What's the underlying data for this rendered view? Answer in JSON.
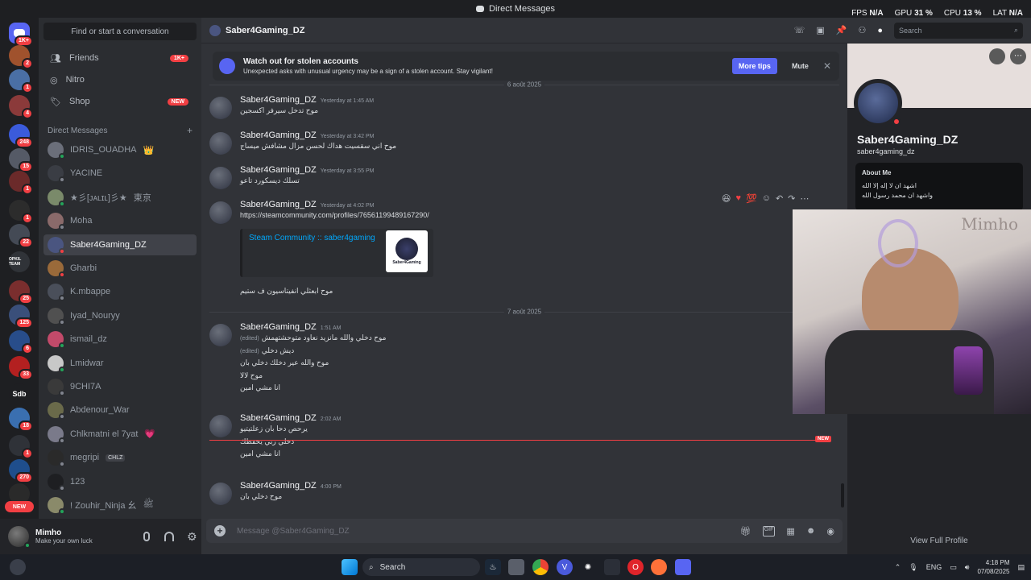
{
  "window": {
    "title": "Direct Messages"
  },
  "overlay": {
    "fps_label": "FPS",
    "fps_value": "N/A",
    "gpu_label": "GPU",
    "gpu_value": "31 %",
    "cpu_label": "CPU",
    "cpu_value": "13 %",
    "lat_label": "LAT",
    "lat_value": "N/A"
  },
  "rail": {
    "home_badge": "1K+",
    "servers": [
      {
        "badge": "2",
        "color": "#a0522d"
      },
      {
        "badge": "1",
        "color": "#4a6fa5"
      },
      {
        "badge": "4",
        "color": "#8b3a3a"
      },
      {
        "badge": "248",
        "color": "#3b5bdb"
      },
      {
        "badge": "15",
        "color": "#555a66"
      },
      {
        "badge": "1",
        "color": "#6b2a2a"
      },
      {
        "badge": "1",
        "color": "#2c2c2c"
      },
      {
        "badge": "22",
        "color": "#444a55"
      },
      {
        "badge": "",
        "color": "#303338",
        "text": "OPKIL TEAM"
      },
      {
        "badge": "25",
        "color": "#7a2e2e"
      },
      {
        "badge": "125",
        "color": "#3a4f7a"
      },
      {
        "badge": "6",
        "color": "#284d8a"
      },
      {
        "badge": "33",
        "color": "#b32020"
      },
      {
        "badge": "",
        "color": "#1e1f22",
        "text": "Sdb"
      },
      {
        "badge": "18",
        "color": "#3a6fb0"
      },
      {
        "badge": "1",
        "color": "#2f3238"
      },
      {
        "badge": "270",
        "color": "#1f4e8c"
      },
      {
        "badge": "",
        "color": "#2a2a2a"
      }
    ],
    "new_label": "NEW"
  },
  "sidebar": {
    "find_placeholder": "Find or start a conversation",
    "nav": [
      {
        "label": "Friends",
        "badge": "1K+",
        "icon": "friends-icon"
      },
      {
        "label": "Nitro",
        "badge": "",
        "icon": "nitro-icon"
      },
      {
        "label": "Shop",
        "badge": "NEW",
        "icon": "shop-icon"
      }
    ],
    "dm_header": "Direct Messages",
    "dms": [
      {
        "name": "IDRIS_OUADHA",
        "extra": "👑",
        "status": "#23a55a",
        "av": "#6b6f7a"
      },
      {
        "name": "YACINE",
        "extra": "",
        "status": "#80848e",
        "av": "#3a3d44"
      },
      {
        "name": "★彡[ᴊᴀʟɪʟ]彡★",
        "extra": "東京",
        "status": "#23a55a",
        "av": "#7a8a6a"
      },
      {
        "name": "Moha",
        "extra": "",
        "status": "#80848e",
        "av": "#8a6a6a"
      },
      {
        "name": "Saber4Gaming_DZ",
        "extra": "",
        "status": "#f23f43",
        "av": "#4a5580",
        "active": true
      },
      {
        "name": "Gharbi",
        "extra": "",
        "status": "#f23f43",
        "av": "#9a6a3a"
      },
      {
        "name": "K.mbappe",
        "extra": "",
        "status": "#80848e",
        "av": "#4a4f5a"
      },
      {
        "name": "Iyad_Nouryy",
        "extra": "",
        "status": "#80848e",
        "av": "#505050"
      },
      {
        "name": "ismail_dz",
        "extra": "",
        "status": "#23a55a",
        "av": "#c24a6a"
      },
      {
        "name": "Lmidwar",
        "extra": "",
        "status": "#23a55a",
        "av": "#c8c8c8"
      },
      {
        "name": "9CHI7A",
        "extra": "",
        "status": "#80848e",
        "av": "#3a3a3a"
      },
      {
        "name": "Abdenour_War",
        "extra": "",
        "status": "#80848e",
        "av": "#6a6a4a"
      },
      {
        "name": "Chlkmatni el 7yat",
        "extra": "💗",
        "status": "#80848e",
        "av": "#7a7a8a"
      },
      {
        "name": "megripi",
        "extra": "CHLZ",
        "status": "#80848e",
        "av": "#2a2a2a"
      },
      {
        "name": "123",
        "extra": "",
        "status": "#80848e",
        "av": "#1e1f22"
      },
      {
        "name": "! Zouhir_Ninja ⺓",
        "extra": "ﷺ",
        "status": "#23a55a",
        "av": "#8a8a6a"
      }
    ]
  },
  "user": {
    "name": "Mimho",
    "status": "Make your own luck"
  },
  "chat": {
    "header_name": "Saber4Gaming_DZ",
    "notice_title": "Watch out for stolen accounts",
    "notice_text": "Unexpected asks with unusual urgency may be a sign of a stolen account. Stay vigilant!",
    "more_tips": "More tips",
    "mute": "Mute",
    "date1": "6 août 2025",
    "date2": "7 août 2025",
    "messages": [
      {
        "author": "Saber4Gaming_DZ",
        "time": "Yesterday at 1:45 AM",
        "lines": [
          "موح تدخل سيرفر اكسجين"
        ]
      },
      {
        "author": "Saber4Gaming_DZ",
        "time": "Yesterday at 3:42 PM",
        "lines": [
          "موح اني سقسيت هداك لحسن مزال مشافش ميساج"
        ]
      },
      {
        "author": "Saber4Gaming_DZ",
        "time": "Yesterday at 3:55 PM",
        "lines": [
          "تسلك ديسكورد تاعو"
        ]
      },
      {
        "author": "Saber4Gaming_DZ",
        "time": "Yesterday at 4:02 PM",
        "lines": [
          "https://steamcommunity.com/profiles/76561199489167290/"
        ]
      },
      {
        "author": "Saber4Gaming_DZ",
        "time": "1:51 AM",
        "lines": [
          "موح دخلي والله مانزيد نعاود متوحشتهمش",
          "ديش دخلي",
          "موح والله عير دخلك دخلي بان",
          "موح لالا",
          "انا مشي امين"
        ]
      },
      {
        "author": "Saber4Gaming_DZ",
        "time": "2:02 AM",
        "lines": [
          "يرحص دحا بان زعلتيتيو",
          "دخلي ربي يحفظك",
          "انا مشي امين"
        ]
      },
      {
        "author": "Saber4Gaming_DZ",
        "time": "4:00 PM",
        "lines": [
          "موح دخلي بان"
        ]
      }
    ],
    "embed_title": "Steam Community :: saber4gaming",
    "embed_thumb_label": "Saber4Gaming",
    "after_embed": "موح ابعثلي انفيتاسيون ف ستيم",
    "edited": "(edited)",
    "new_label": "NEW",
    "composer_placeholder": "Message @Saber4Gaming_DZ",
    "search_placeholder": "Search"
  },
  "profile": {
    "display_name": "Saber4Gaming_DZ",
    "username": "saber4gaming_dz",
    "about_title": "About Me",
    "about_lines": [
      "اشهد ان لا إله إلا الله",
      "واشهد ان محمد رسول الله"
    ],
    "view_full": "View Full Profile"
  },
  "webcam": {
    "watermark": "Mimho"
  },
  "taskbar": {
    "search": "Search",
    "lang": "ENG",
    "time": "4:18 PM",
    "date": "07/08/2025"
  }
}
